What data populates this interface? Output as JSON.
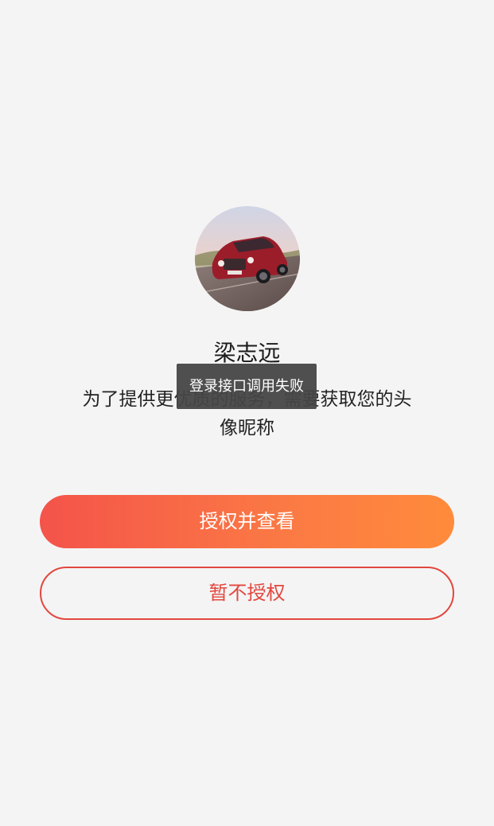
{
  "profile": {
    "avatar_alt": "red-suv-avatar",
    "nickname": "梁志远"
  },
  "auth": {
    "description": "为了提供更优质的服务，需要获取您的头像昵称",
    "authorize_button": "授权并查看",
    "decline_button": "暂不授权"
  },
  "toast": {
    "message": "登录接口调用失败"
  },
  "colors": {
    "accent_start": "#f4534a",
    "accent_end": "#ff8b3b",
    "decline_border": "#e2473e",
    "background": "#f4f4f4"
  }
}
